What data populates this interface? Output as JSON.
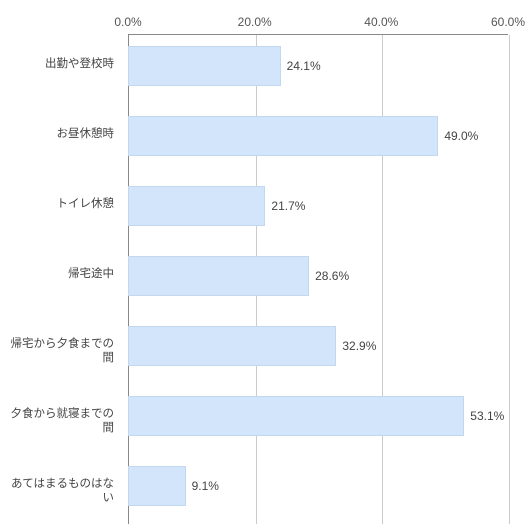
{
  "chart_data": {
    "type": "bar",
    "orientation": "horizontal",
    "categories": [
      "出勤や登校時",
      "お昼休憩時",
      "トイレ休憩",
      "帰宅途中",
      "帰宅から夕食までの間",
      "夕食から就寝までの間",
      "あてはまるものはない"
    ],
    "values": [
      24.1,
      49.0,
      21.7,
      28.6,
      32.9,
      53.1,
      9.1
    ],
    "value_labels": [
      "24.1%",
      "49.0%",
      "21.7%",
      "28.6%",
      "32.9%",
      "53.1%",
      "9.1%"
    ],
    "xlim": [
      0,
      60
    ],
    "xticks": [
      0.0,
      20.0,
      40.0,
      60.0
    ],
    "xtick_labels": [
      "0.0%",
      "20.0%",
      "40.0%",
      "60.0%"
    ],
    "title": "",
    "xlabel": "",
    "ylabel": ""
  }
}
